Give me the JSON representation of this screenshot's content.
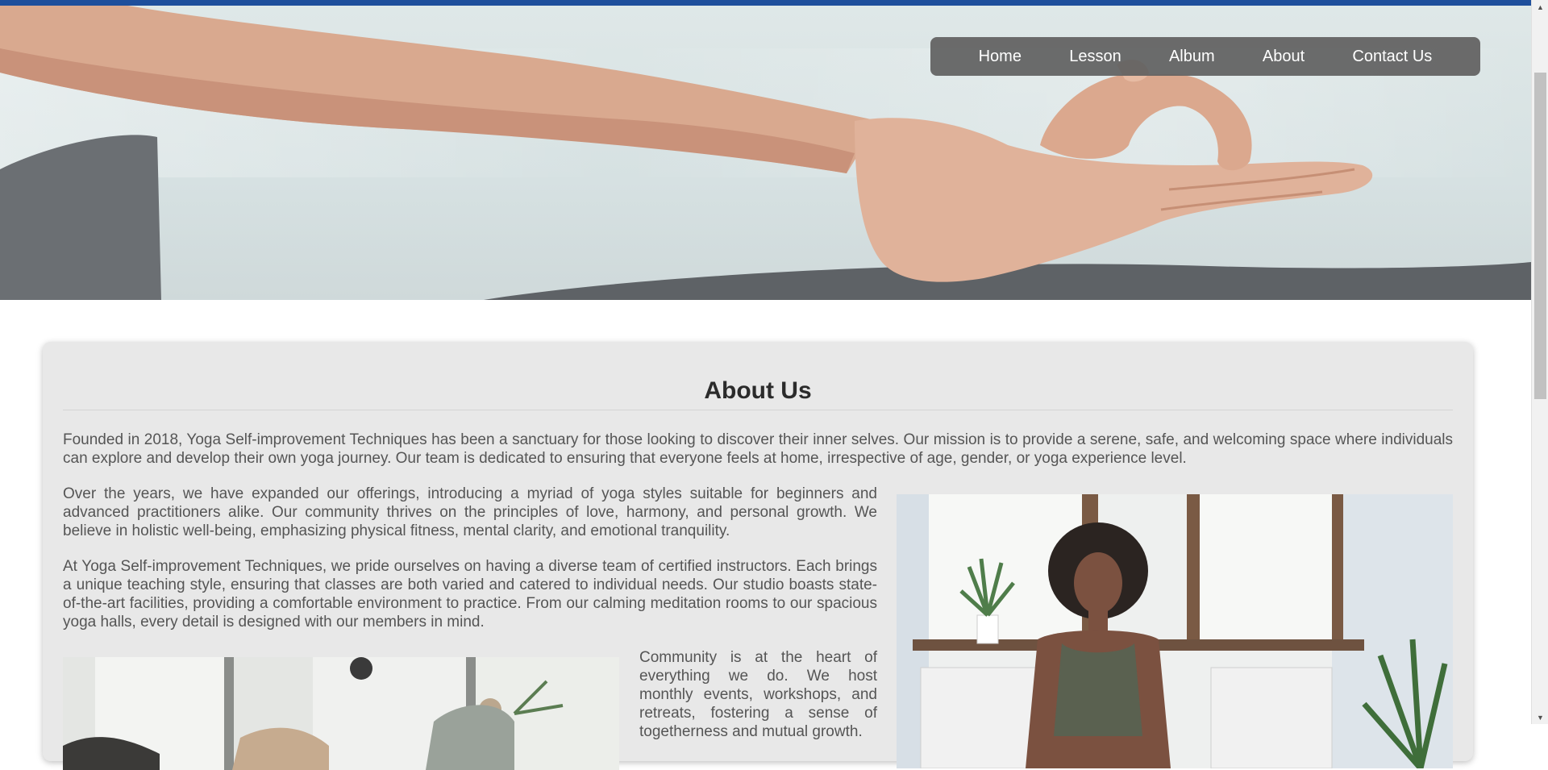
{
  "nav": {
    "items": [
      "Home",
      "Lesson",
      "Album",
      "About",
      "Contact Us"
    ]
  },
  "about": {
    "title": "About Us",
    "paragraphs": [
      "Founded in 2018, Yoga Self-improvement Techniques has been a sanctuary for those looking to discover their inner selves. Our mission is to provide a serene, safe, and welcoming space where individuals can explore and develop their own yoga journey. Our team is dedicated to ensuring that everyone feels at home, irrespective of age, gender, or yoga experience level.",
      "Over the years, we have expanded our offerings, introducing a myriad of yoga styles suitable for beginners and advanced practitioners alike. Our community thrives on the principles of love, harmony, and personal growth. We believe in holistic well-being, emphasizing physical fitness, mental clarity, and emotional tranquility.",
      "At Yoga Self-improvement Techniques, we pride ourselves on having a diverse team of certified instructors. Each brings a unique teaching style, ensuring that classes are both varied and catered to individual needs. Our studio boasts state-of-the-art facilities, providing a comfortable environment to practice. From our calming meditation rooms to our spacious yoga halls, every detail is designed with our members in mind.",
      "Community is at the heart of everything we do. We host monthly events, workshops, and retreats, fostering a sense of togetherness and mutual growth."
    ]
  },
  "colors": {
    "topbar": "#1e4f9c",
    "nav_bg": "#5f5f5f",
    "card_bg": "#e8e8e8"
  }
}
